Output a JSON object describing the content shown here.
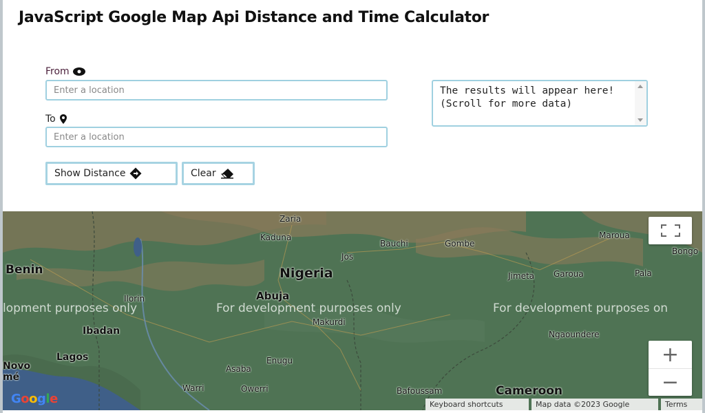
{
  "title": "JavaScript Google Map Api Distance and Time Calculator",
  "form": {
    "from_label": "From",
    "to_label": "To",
    "from_placeholder": "Enter a location",
    "to_placeholder": "Enter a location",
    "from_value": "",
    "to_value": "",
    "results_text": "The results will appear here! (Scroll for more data)",
    "show_distance_label": "Show Distance",
    "clear_label": "Clear"
  },
  "map": {
    "watermark": "For development purposes only",
    "watermark_left": "lopment purposes only",
    "watermark_mid": "For development purposes only",
    "watermark_right": "For development purposes on",
    "logo": "Google",
    "places": {
      "zaria": "Zaria",
      "kaduna": "Kaduna",
      "bauchi": "Bauchi",
      "gombe": "Gombe",
      "maroua": "Maroua",
      "benin": "Benin",
      "jos": "Jos",
      "nigeria": "Nigeria",
      "jimeta": "Jimeta",
      "garoua": "Garoua",
      "pala": "Pala",
      "bongo": "Bongo",
      "ilorin": "Ilorin",
      "abuja": "Abuja",
      "makurdi": "Makurdi",
      "ibadan": "Ibadan",
      "ngaoundere": "Ngaoundere",
      "lagos": "Lagos",
      "novo": "Novo",
      "me": "mé",
      "enugu": "Enugu",
      "asaba": "Asaba",
      "warri": "Warri",
      "owerri": "Owerri",
      "bafoussam": "Bafoussam",
      "cameroon": "Cameroon"
    },
    "keyboard_shortcuts": "Keyboard shortcuts",
    "map_data": "Map data ©2023 Google",
    "terms": "Terms",
    "zoom_in": "+",
    "zoom_out": "−"
  },
  "colors": {
    "input_border": "#9fd0e0",
    "map_green": "#4f7354",
    "map_brown": "#8a7a5a",
    "sea": "#3f5f88"
  }
}
